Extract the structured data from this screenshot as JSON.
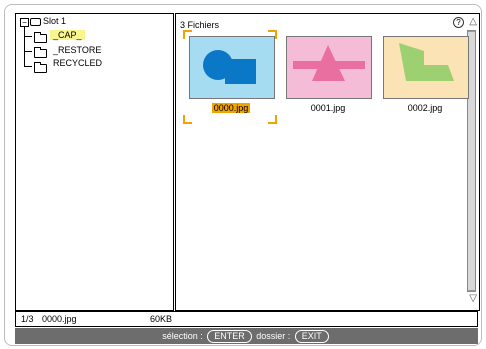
{
  "tree": {
    "root_label": "Slot 1",
    "items": [
      {
        "label": "_CAP_",
        "selected": true
      },
      {
        "label": "_RESTORE",
        "selected": false
      },
      {
        "label": "RECYCLED",
        "selected": false
      }
    ]
  },
  "files": {
    "count_label": "3 Fichiers",
    "help_icon": "?",
    "scroll_up_icon": "△",
    "scroll_down_icon": "▽",
    "items": [
      {
        "name": "0000.jpg",
        "selected": true,
        "bg": "#a6dcf2",
        "shape_color": "#0a78c6"
      },
      {
        "name": "0001.jpg",
        "selected": false,
        "bg": "#f5bcd7",
        "shape_color": "#e86f9f"
      },
      {
        "name": "0002.jpg",
        "selected": false,
        "bg": "#fbe3b5",
        "shape_color": "#9cd070"
      }
    ]
  },
  "status": {
    "position": "1/3",
    "filename": "0000.jpg",
    "size": "60KB"
  },
  "help_bar": {
    "select_label": "sélection :",
    "select_key": "ENTER",
    "folder_label": "dossier :",
    "folder_key": "EXIT"
  },
  "colors": {
    "selection_highlight": "#f8f58e",
    "cursor_accent": "#f1a300",
    "help_bar_bg": "#6d6d6d"
  }
}
